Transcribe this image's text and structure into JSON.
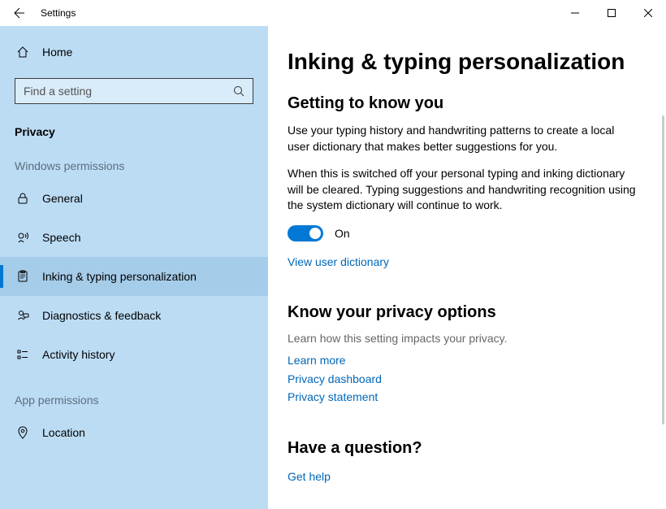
{
  "titlebar": {
    "title": "Settings"
  },
  "sidebar": {
    "home": "Home",
    "search_placeholder": "Find a setting",
    "section": "Privacy",
    "group_windows": "Windows permissions",
    "group_app": "App permissions",
    "items": {
      "general": "General",
      "speech": "Speech",
      "inking": "Inking & typing personalization",
      "diagnostics": "Diagnostics & feedback",
      "activity": "Activity history",
      "location": "Location"
    }
  },
  "main": {
    "title": "Inking & typing personalization",
    "section1": {
      "heading": "Getting to know you",
      "para1": "Use your typing history and handwriting patterns to create a local user dictionary that makes better suggestions for you.",
      "para2": "When this is switched off your personal typing and inking dictionary will be cleared. Typing suggestions and handwriting recognition using the system dictionary will continue to work.",
      "toggle_label": "On",
      "link_dictionary": "View user dictionary"
    },
    "section2": {
      "heading": "Know your privacy options",
      "sub": "Learn how this setting impacts your privacy.",
      "link_learn": "Learn more",
      "link_dashboard": "Privacy dashboard",
      "link_statement": "Privacy statement"
    },
    "section3": {
      "heading": "Have a question?",
      "link_help": "Get help"
    }
  }
}
